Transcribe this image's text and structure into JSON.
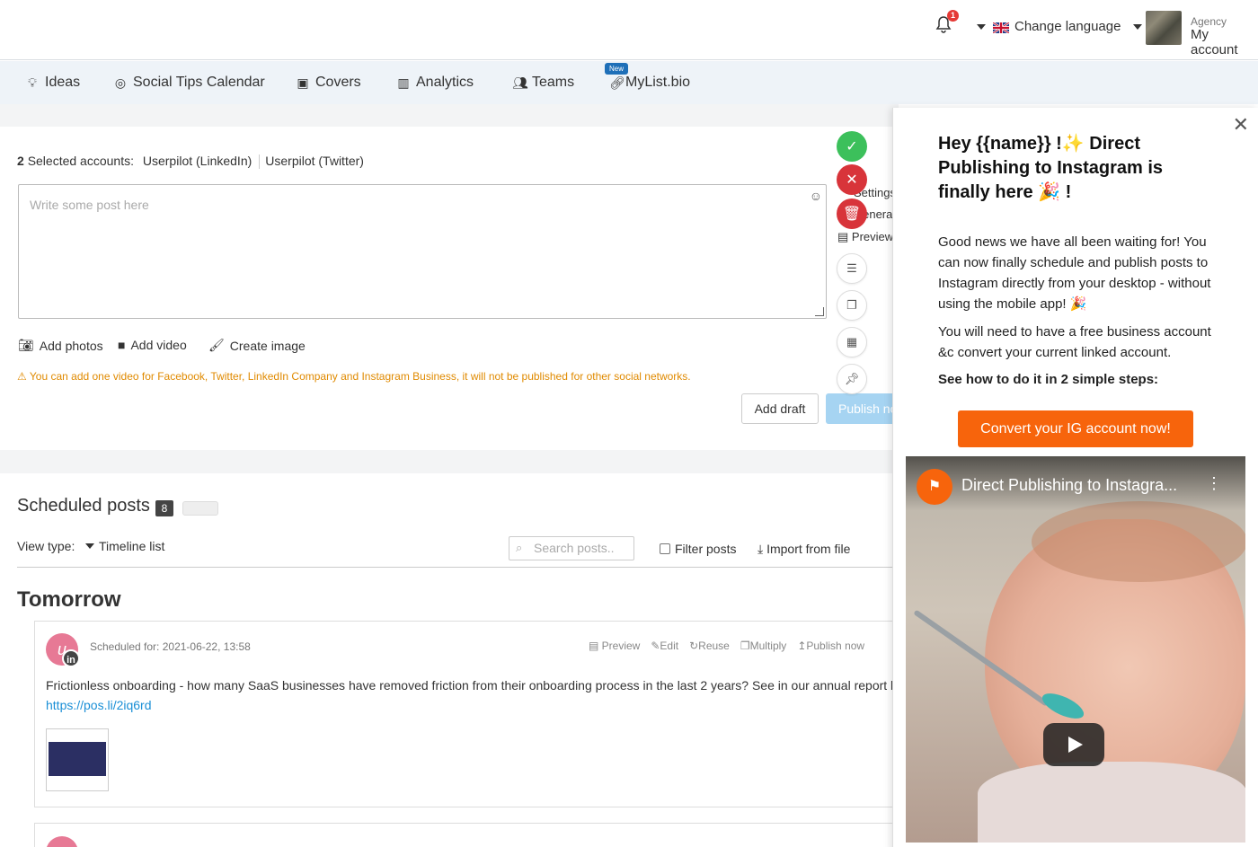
{
  "topbar": {
    "notification_count": "1",
    "language_label": "Change language",
    "account_role": "Agency",
    "account_label": "My account"
  },
  "nav": {
    "items": [
      {
        "label": "Ideas",
        "icon": "lightbulb-icon"
      },
      {
        "label": "Social Tips Calendar",
        "icon": "compass-icon"
      },
      {
        "label": "Covers",
        "icon": "image-icon"
      },
      {
        "label": "Analytics",
        "icon": "bar-chart-icon"
      },
      {
        "label": "Teams",
        "icon": "users-icon"
      },
      {
        "label": "MyList.bio",
        "icon": "link-icon"
      }
    ],
    "new_badge": "New"
  },
  "composer": {
    "selected_count": "2",
    "selected_label": "Selected accounts:",
    "accounts": [
      "Userpilot (LinkedIn)",
      "Userpilot (Twitter)"
    ],
    "placeholder": "Write some post here",
    "add_photos": "Add photos",
    "add_video": "Add video",
    "create_image": "Create image",
    "warning": "You can add one video for Facebook, Twitter, LinkedIn Company and Instagram Business, it will not be published for other social networks.",
    "add_draft": "Add draft",
    "publish_now": "Publish now",
    "side_settings": "Settings",
    "side_general": "General",
    "side_preview": "Preview"
  },
  "scheduled": {
    "title": "Scheduled posts",
    "count": "8",
    "view_type_label": "View type:",
    "view_type_value": "Timeline list",
    "search_placeholder": "Search posts..",
    "filter_label": "Filter posts",
    "import_label": "Import from file",
    "group_heading": "Tomorrow",
    "posts": [
      {
        "avatar_letter": "u",
        "network": "in",
        "scheduled_for": "Scheduled for: 2021-06-22, 13:58",
        "actions": [
          "Preview",
          "Edit",
          "Reuse",
          "Multiply",
          "Publish now"
        ],
        "text": "Frictionless onboarding - how many SaaS businesses have removed friction from their onboarding process in the last 2 years? See in our annual report below",
        "link": "https://pos.li/2iq6rd"
      }
    ]
  },
  "popup": {
    "title": "Hey {{name}} !✨  Direct Publishing to Instagram is finally here 🎉 !",
    "paragraph1": "Good news we have all been waiting for! You can now finally schedule and publish posts to Instagram directly from your desktop - without using the mobile app! 🎉",
    "paragraph2": "You will need to have a free business account &c convert your current linked account.",
    "steps_heading": "See how to do it in 2 simple steps:",
    "cta": "Convert your IG account now!",
    "video_title": "Direct Publishing to Instagra..."
  },
  "colors": {
    "accent_orange": "#f7640c",
    "nav_bg": "#eef3f8",
    "approve_green": "#3cc05b",
    "reject_red": "#d8343a",
    "link_blue": "#1a8fd6"
  }
}
